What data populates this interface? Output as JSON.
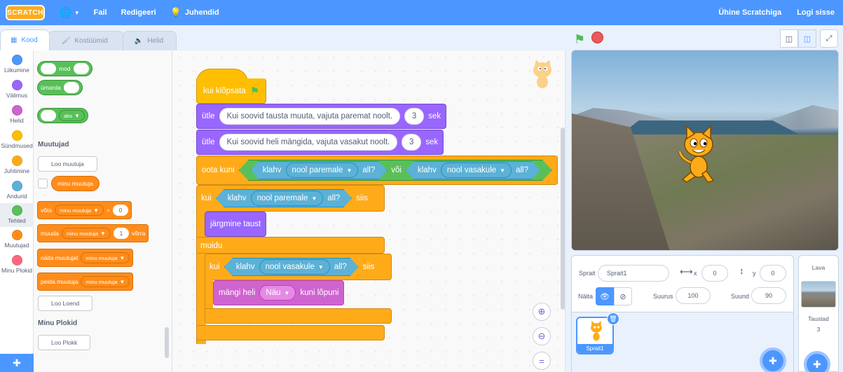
{
  "menubar": {
    "logo": "SCRATCH",
    "file": "Fail",
    "edit": "Redigeeri",
    "tutorials": "Juhendid",
    "join": "Ühine Scratchiga",
    "signin": "Logi sisse"
  },
  "tabs": {
    "code": "Kood",
    "costumes": "Kostüümid",
    "sounds": "Helid"
  },
  "categories": [
    "Liikumine",
    "Välimus",
    "Helid",
    "Sündmused",
    "Juhtimine",
    "Andurid",
    "Tehted",
    "Muutujad",
    "Minu Plokid"
  ],
  "category_colors": [
    "#4c97ff",
    "#9966ff",
    "#cf63cf",
    "#ffbf00",
    "#ffab19",
    "#5cb1d6",
    "#59c059",
    "#ff8c1a",
    "#ff6680"
  ],
  "palette": {
    "mod": "mod",
    "round": "ümarda",
    "abs": "abs",
    "variables_head": "Muutujad",
    "make_variable": "Loo muutuja",
    "my_variable": "minu muutuja",
    "set": "võta",
    "set_value": "0",
    "change": "muuda",
    "change_value": "1",
    "change_by": "võrra",
    "show_var": "näita muutujat",
    "hide_var": "peida muutuja",
    "make_list": "Loo Loend",
    "myblocks_head": "Minu Plokid",
    "make_block": "Loo Plokk",
    "equals": "="
  },
  "script": {
    "when_flag": "kui klõpsata",
    "say1_prefix": "ütle",
    "say1_text": "Kui soovid tausta muuta, vajuta paremat noolt.",
    "say1_secs": "3",
    "say_suffix": "sek",
    "say2_prefix": "ütle",
    "say2_text": "Kui soovid heli mängida, vajuta vasakut noolt.",
    "say2_secs": "3",
    "wait_until": "oota kuni",
    "key": "klahv",
    "right_arrow": "nool paremale",
    "left_arrow": "nool vasakule",
    "pressed": "all?",
    "or": "või",
    "if": "kui",
    "then": "siis",
    "next_backdrop": "järgmine taust",
    "else": "muidu",
    "play_sound": "mängi heli",
    "sound_name": "Näu",
    "until_done": "kuni lõpuni"
  },
  "sprite_info": {
    "sprite_label": "Sprait",
    "sprite_name": "Sprait1",
    "x_label": "x",
    "x_value": "0",
    "y_label": "y",
    "y_value": "0",
    "show_label": "Näita",
    "size_label": "Suurus",
    "size_value": "100",
    "direction_label": "Suund",
    "direction_value": "90"
  },
  "sprite_list": {
    "sprite1": "Sprait1"
  },
  "stage_panel": {
    "title": "Lava",
    "backdrops_label": "Taustad",
    "backdrops_count": "3"
  }
}
